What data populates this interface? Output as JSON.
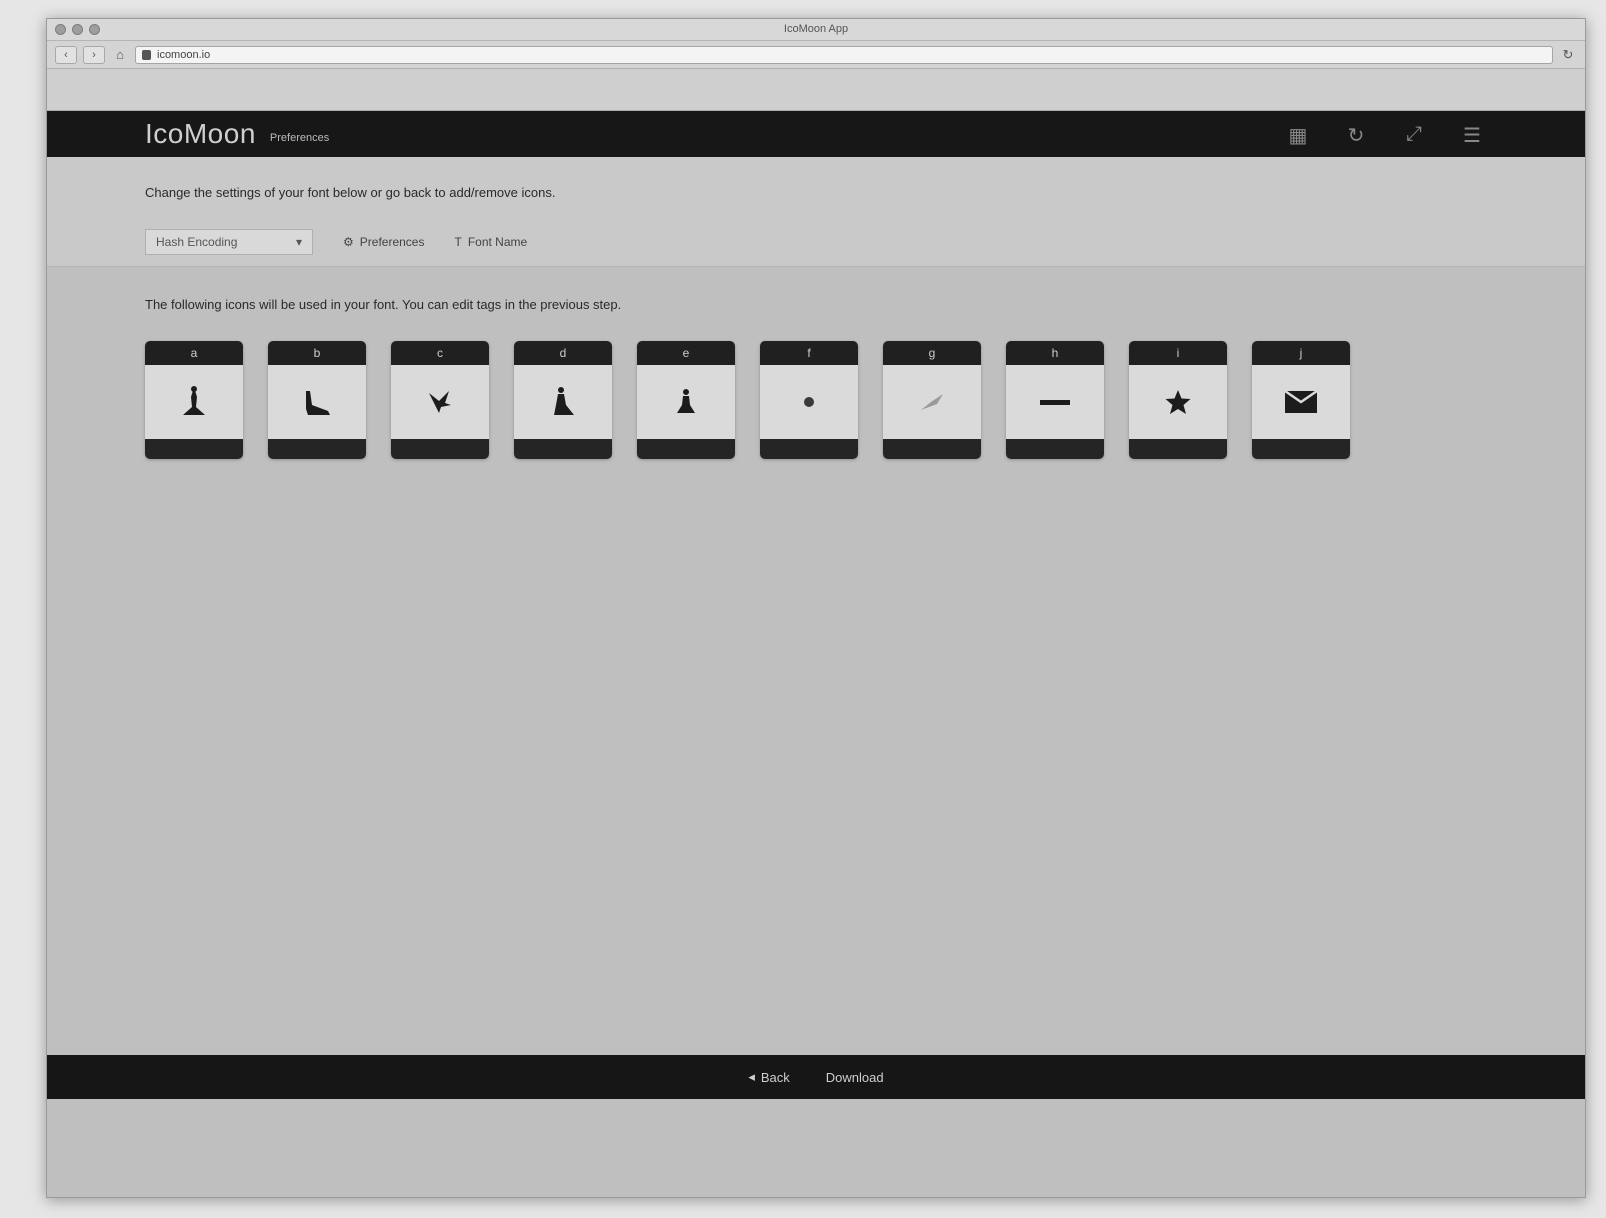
{
  "browser": {
    "window_title": "IcoMoon App",
    "url": "icomoon.io",
    "bookmarks": [
      "",
      "",
      "",
      "",
      "",
      "",
      "",
      "",
      "",
      "",
      "",
      "",
      "",
      "",
      "",
      "",
      "",
      "",
      "",
      "",
      "",
      ""
    ]
  },
  "app": {
    "logo": "IcoMoon",
    "breadcrumb_prefix": "",
    "breadcrumb_current": "Preferences",
    "header_icons": [
      "grid-icon",
      "refresh-icon",
      "expand-icon",
      "menu-icon"
    ]
  },
  "content": {
    "intro_text": "Change the settings of your font below or go back to add/remove icons.",
    "encoding_select": "Hash Encoding",
    "preferences_link": "Preferences",
    "font_name_link": "Font Name",
    "note_text": "The following icons will be used in your font. You can edit tags in the previous step.",
    "glyphs": [
      {
        "code": "a",
        "name": "",
        "icon": "figure-icon"
      },
      {
        "code": "b",
        "name": "",
        "icon": "boot-icon"
      },
      {
        "code": "c",
        "name": "",
        "icon": "bird-icon"
      },
      {
        "code": "d",
        "name": "",
        "icon": "figure-seated-icon"
      },
      {
        "code": "e",
        "name": "",
        "icon": "figure-standing-icon"
      },
      {
        "code": "f",
        "name": "",
        "icon": "dot-icon"
      },
      {
        "code": "g",
        "name": "",
        "icon": "feather-icon"
      },
      {
        "code": "h",
        "name": "",
        "icon": "dash-icon"
      },
      {
        "code": "i",
        "name": "",
        "icon": "star-icon"
      },
      {
        "code": "j",
        "name": "",
        "icon": "envelope-icon"
      }
    ]
  },
  "footer": {
    "back_label": "Back",
    "download_label": "Download"
  }
}
